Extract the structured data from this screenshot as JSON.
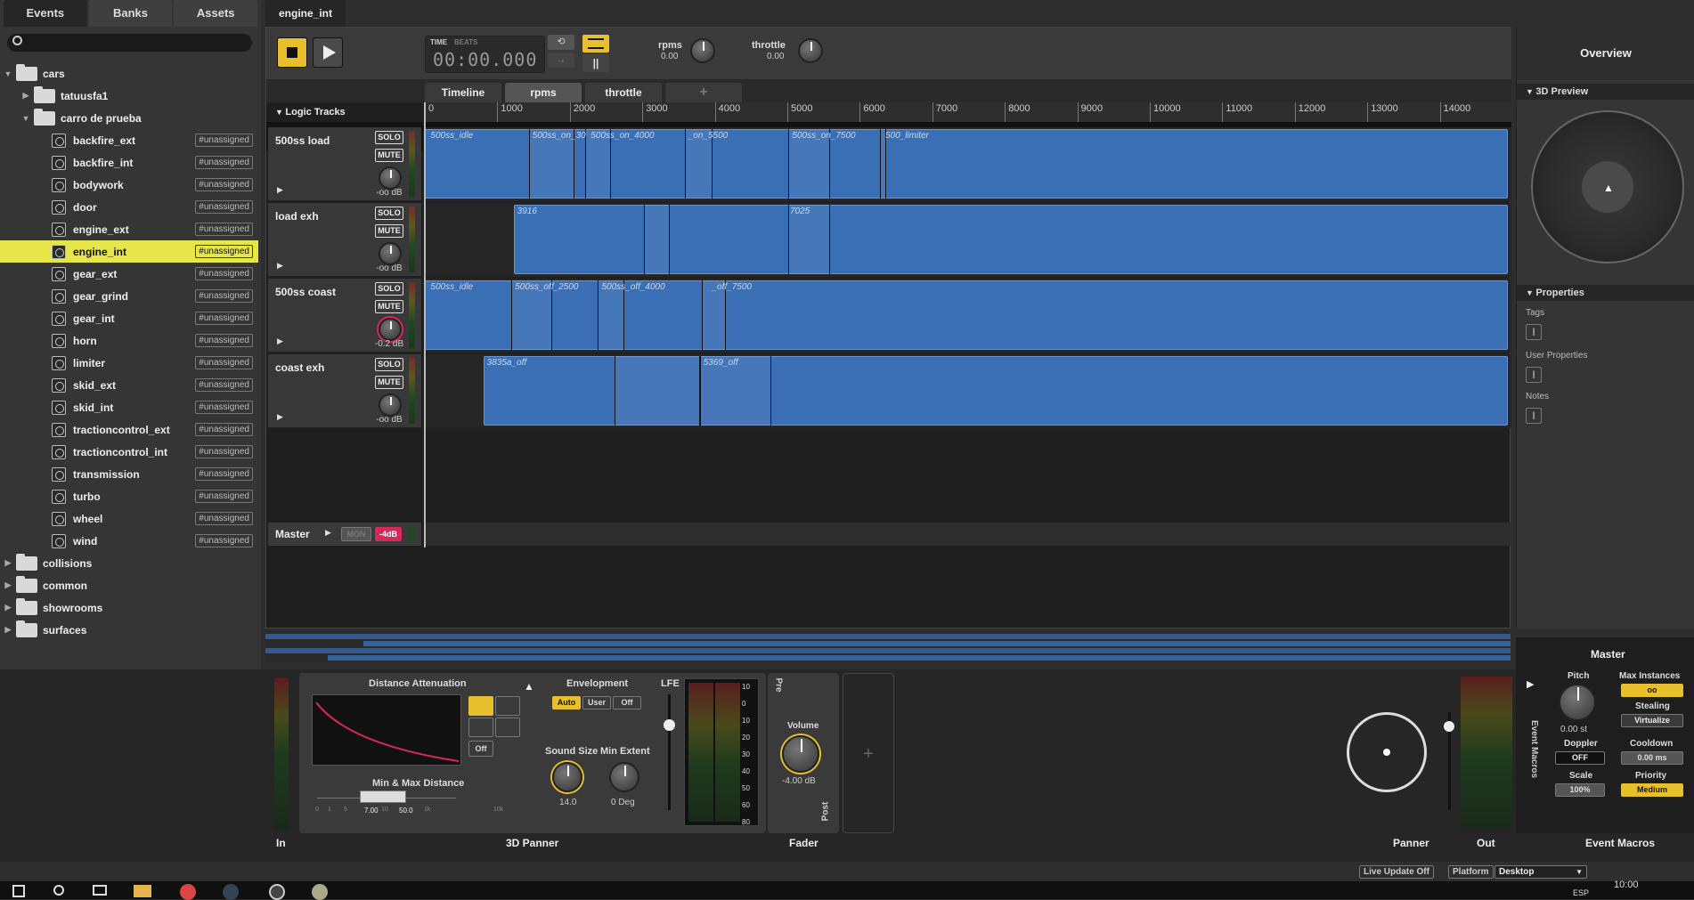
{
  "left_panel": {
    "tabs": [
      "Events",
      "Banks",
      "Assets"
    ],
    "tree": [
      {
        "label": "cars",
        "type": "folder",
        "expanded": true
      },
      {
        "label": "tatuusfa1",
        "type": "folder",
        "expanded": false
      },
      {
        "label": "carro de prueba",
        "type": "folder",
        "expanded": true
      },
      {
        "label": "backfire_ext",
        "type": "event",
        "tag": "#unassigned"
      },
      {
        "label": "backfire_int",
        "type": "event",
        "tag": "#unassigned"
      },
      {
        "label": "bodywork",
        "type": "event",
        "tag": "#unassigned"
      },
      {
        "label": "door",
        "type": "event",
        "tag": "#unassigned"
      },
      {
        "label": "engine_ext",
        "type": "event",
        "tag": "#unassigned"
      },
      {
        "label": "engine_int",
        "type": "event",
        "tag": "#unassigned",
        "selected": true
      },
      {
        "label": "gear_ext",
        "type": "event",
        "tag": "#unassigned"
      },
      {
        "label": "gear_grind",
        "type": "event",
        "tag": "#unassigned"
      },
      {
        "label": "gear_int",
        "type": "event",
        "tag": "#unassigned"
      },
      {
        "label": "horn",
        "type": "event",
        "tag": "#unassigned"
      },
      {
        "label": "limiter",
        "type": "event",
        "tag": "#unassigned"
      },
      {
        "label": "skid_ext",
        "type": "event",
        "tag": "#unassigned"
      },
      {
        "label": "skid_int",
        "type": "event",
        "tag": "#unassigned"
      },
      {
        "label": "tractioncontrol_ext",
        "type": "event",
        "tag": "#unassigned"
      },
      {
        "label": "tractioncontrol_int",
        "type": "event",
        "tag": "#unassigned"
      },
      {
        "label": "transmission",
        "type": "event",
        "tag": "#unassigned"
      },
      {
        "label": "turbo",
        "type": "event",
        "tag": "#unassigned"
      },
      {
        "label": "wheel",
        "type": "event",
        "tag": "#unassigned"
      },
      {
        "label": "wind",
        "type": "event",
        "tag": "#unassigned"
      },
      {
        "label": "collisions",
        "type": "folder",
        "expanded": false
      },
      {
        "label": "common",
        "type": "folder",
        "expanded": false
      },
      {
        "label": "showrooms",
        "type": "folder",
        "expanded": false
      },
      {
        "label": "surfaces",
        "type": "folder",
        "expanded": false
      }
    ]
  },
  "editor": {
    "tab_title": "engine_int",
    "transport": {
      "time_label": "TIME",
      "beats_label": "BEATS",
      "time_value": "00:00.000",
      "params": [
        {
          "name": "rpms",
          "value": "0.00"
        },
        {
          "name": "throttle",
          "value": "0.00"
        }
      ]
    },
    "timeline_tabs": [
      "Timeline",
      "rpms",
      "throttle",
      "+"
    ],
    "active_timeline_tab": "rpms",
    "logic_tracks_label": "Logic Tracks",
    "ruler_ticks": [
      "0",
      "1000",
      "2000",
      "3000",
      "4000",
      "5000",
      "6000",
      "7000",
      "8000",
      "9000",
      "10000",
      "11000",
      "12000",
      "13000",
      "14000"
    ],
    "tracks": [
      {
        "name": "500ss load",
        "solo": "SOLO",
        "mute": "MUTE",
        "volume": "-oo dB",
        "regions": [
          "500ss_idle",
          "500ss_on_30",
          "500ss_on_4000",
          "_on_5500",
          "500ss_on_7500",
          "500_limiter"
        ]
      },
      {
        "name": "load exh",
        "solo": "SOLO",
        "mute": "MUTE",
        "volume": "-oo dB",
        "regions": [
          "3916",
          "7025"
        ]
      },
      {
        "name": "500ss coast",
        "solo": "SOLO",
        "mute": "MUTE",
        "volume": "-0.2 dB",
        "regions": [
          "500ss_idle",
          "500ss_off_2500",
          "500ss_off_4000",
          "_off_7500"
        ]
      },
      {
        "name": "coast exh",
        "solo": "SOLO",
        "mute": "MUTE",
        "volume": "-oo dB",
        "regions": [
          "3835a_off",
          "5369_off"
        ]
      }
    ],
    "master": {
      "name": "Master",
      "mon": "MON",
      "level": "-4dB"
    }
  },
  "right_panel": {
    "title": "Overview",
    "preview_label": "3D Preview",
    "properties_label": "Properties",
    "tags_label": "Tags",
    "user_props_label": "User Properties",
    "notes_label": "Notes"
  },
  "deck": {
    "in_label": "In",
    "panner3d_label": "3D Panner",
    "distance_att_label": "Distance Attenuation",
    "off_label": "Off",
    "envelopment_label": "Envelopment",
    "env_modes": [
      "Auto",
      "User",
      "Off"
    ],
    "lfe_label": "LFE",
    "sound_size_label": "Sound Size",
    "sound_size_value": "14.0",
    "min_extent_label": "Min Extent",
    "min_extent_value": "0 Deg",
    "min_max_label": "Min & Max Distance",
    "min_distance": "7.00",
    "max_distance": "50.0",
    "scale_ticks": [
      "0",
      "1",
      "5",
      "10",
      "1k",
      "10k"
    ],
    "meter_ticks": [
      "10",
      "0",
      "10",
      "20",
      "30",
      "40",
      "50",
      "60",
      "80"
    ],
    "fader_label": "Fader",
    "pre_label": "Pre",
    "post_label": "Post",
    "volume_label": "Volume",
    "volume_value": "-4.00 dB",
    "panner_label": "Panner",
    "out_label": "Out",
    "event_macros_side": "Event Macros",
    "master_title": "Master",
    "pitch_label": "Pitch",
    "pitch_value": "0.00 st",
    "max_instances_label": "Max Instances",
    "max_instances_value": "oo",
    "stealing_label": "Stealing",
    "stealing_value": "Virtualize",
    "doppler_label": "Doppler",
    "doppler_value": "OFF",
    "cooldown_label": "Cooldown",
    "cooldown_value": "0.00 ms",
    "scale_label": "Scale",
    "scale_value": "100%",
    "priority_label": "Priority",
    "priority_value": "Medium",
    "event_macros_label": "Event Macros"
  },
  "status_bar": {
    "live_update": "Live Update Off",
    "platform_label": "Platform",
    "platform_value": "Desktop"
  },
  "taskbar": {
    "lang": "ESP",
    "clock": "10:00"
  },
  "colors": {
    "accent_yellow": "#e8c02e",
    "selection": "#e6e64a",
    "region_blue": "#3a6fb5",
    "master_red": "#d6285a"
  }
}
